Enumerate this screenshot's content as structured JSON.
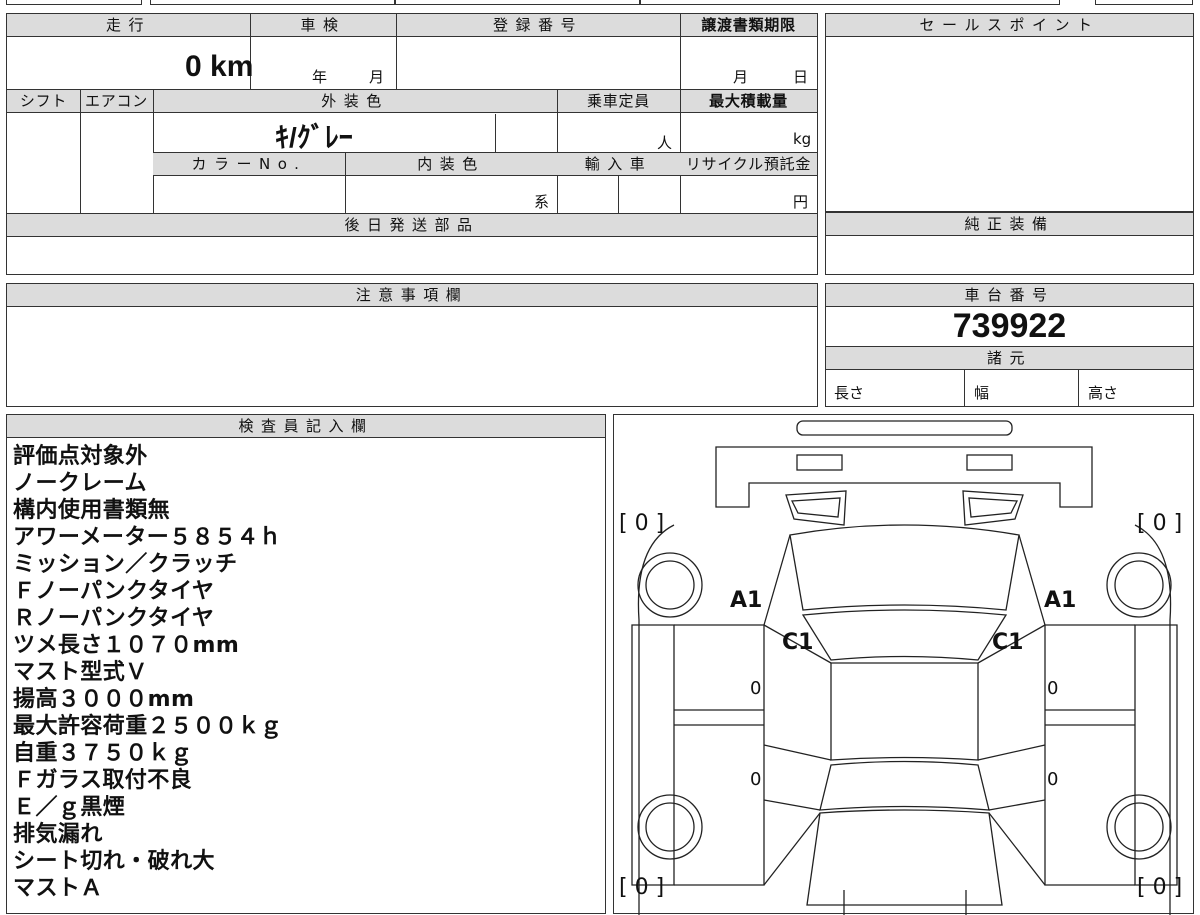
{
  "grid": {
    "mileage_header": "走行",
    "mileage_value": "0",
    "mileage_unit": "km",
    "shaken_header": "車検",
    "shaken_year": "年",
    "shaken_month": "月",
    "registration_header": "登録番号",
    "transfer_header": "譲渡書類期限",
    "transfer_month": "月",
    "transfer_day": "日",
    "shift_header": "シフト",
    "ac_header": "エアコン",
    "exterior_header": "外装色",
    "exterior_value": "ｷ/ｸﾞﾚｰ",
    "capacity_header": "乗車定員",
    "capacity_unit": "人",
    "max_load_header": "最大積載量",
    "max_load_unit": "kg",
    "color_no_header": "カラーNo.",
    "interior_header": "内装色",
    "interior_unit": "系",
    "import_header": "輸入車",
    "recycle_header": "リサイクル預託金",
    "recycle_unit": "円",
    "later_parts_header": "後日発送部品",
    "notes_header": "注意事項欄"
  },
  "right": {
    "sales_point_header": "セールスポイント",
    "genuine_header": "純正装備",
    "chassis_header": "車台番号",
    "chassis_value": "739922",
    "specs_header": "諸元",
    "length_label": "長さ",
    "width_label": "幅",
    "height_label": "高さ"
  },
  "inspector": {
    "header": "検査員記入欄",
    "lines": [
      "評価点対象外",
      "ノークレーム",
      "構内使用書類無",
      "アワーメーター５８５４ｈ",
      "ミッション／クラッチ",
      "Ｆノーパンクタイヤ",
      "Ｒノーパンクタイヤ",
      "ツメ長さ１０７０mm",
      "マスト型式Ｖ",
      "揚高３０００mm",
      "最大許容荷重２５００ｋｇ",
      "自重３７５０ｋｇ",
      "Ｆガラス取付不良",
      "Ｅ／ｇ黒煙",
      "排気漏れ",
      "シート切れ・破れ大",
      "マストＡ"
    ]
  },
  "diagram": {
    "tire_fl": "[ 0 ]",
    "tire_fr": "[ 0 ]",
    "tire_rl": "[ 0 ]",
    "tire_rr": "[ 0 ]",
    "mark_a1_left": "A1",
    "mark_a1_right": "A1",
    "mark_c1_left": "C1",
    "mark_c1_right": "C1",
    "door_fl": "0",
    "door_fr": "0",
    "door_rl": "0",
    "door_rr": "0"
  }
}
